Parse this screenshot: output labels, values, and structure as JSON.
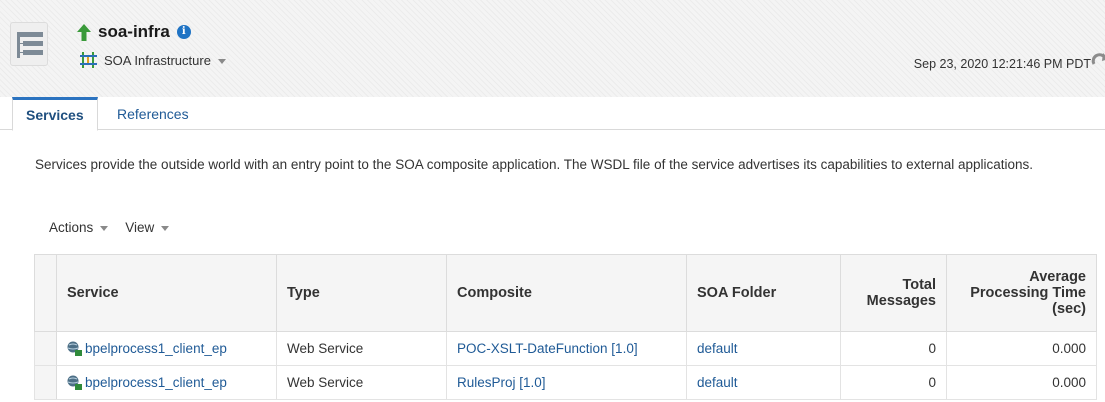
{
  "header": {
    "app_title": "soa-infra",
    "target_label": "SOA Infrastructure",
    "timestamp": "Sep 23, 2020 12:21:46 PM PDT",
    "icons": [
      "menu-icon",
      "up-arrow-icon",
      "info-icon",
      "soa-infrastructure-icon",
      "refresh-icon"
    ],
    "colors": {
      "up_arrow": "#3a9a3a",
      "info": "#1f73c4",
      "link": "#1f5a96",
      "active_tab_border": "#2b73c0"
    }
  },
  "tabs": [
    {
      "label": "Services",
      "active": true
    },
    {
      "label": "References",
      "active": false
    }
  ],
  "description": "Services provide the outside world with an entry point to the SOA composite application. The WSDL file of the service advertises its capabilities to external applications.",
  "toolbar": {
    "actions_label": "Actions",
    "view_label": "View"
  },
  "table": {
    "columns": {
      "service": "Service",
      "type": "Type",
      "composite": "Composite",
      "folder": "SOA Folder",
      "total_messages": "Total Messages",
      "avg_time": "Average Processing Time (sec)"
    },
    "rows": [
      {
        "service": "bpelprocess1_client_ep",
        "type": "Web Service",
        "composite": "POC-XSLT-DateFunction [1.0]",
        "folder": "default",
        "total_messages": "0",
        "avg_time": "0.000"
      },
      {
        "service": "bpelprocess1_client_ep",
        "type": "Web Service",
        "composite": "RulesProj [1.0]",
        "folder": "default",
        "total_messages": "0",
        "avg_time": "0.000"
      }
    ]
  }
}
